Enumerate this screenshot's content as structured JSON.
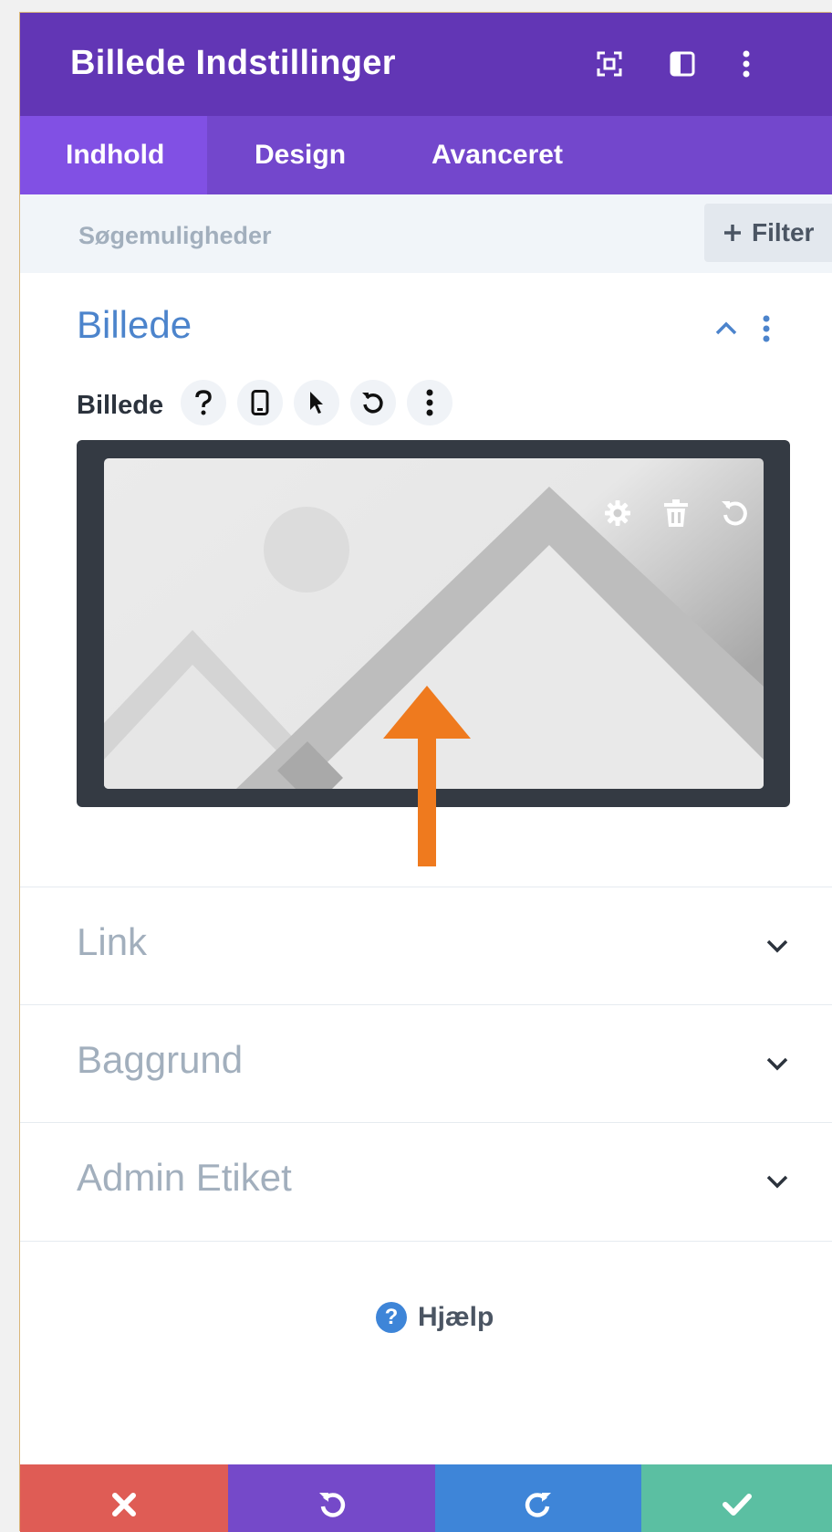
{
  "header": {
    "title": "Billede Indstillinger"
  },
  "tabs": [
    {
      "label": "Indhold",
      "active": true
    },
    {
      "label": "Design",
      "active": false
    },
    {
      "label": "Avanceret",
      "active": false
    }
  ],
  "search": {
    "placeholder": "Søgemuligheder",
    "filter_label": "Filter"
  },
  "image_section": {
    "title": "Billede",
    "field_label": "Billede"
  },
  "accordions": [
    {
      "title": "Link"
    },
    {
      "title": "Baggrund"
    },
    {
      "title": "Admin Etiket"
    }
  ],
  "help": {
    "label": "Hjælp",
    "icon_glyph": "?"
  },
  "colors": {
    "header": "#6236b5",
    "tabs": "#7347cc",
    "active_tab": "#8150e4",
    "section_title": "#4c84cc",
    "arrow": "#ef7a1e",
    "cancel": "#df5c55",
    "undo": "#7549c9",
    "redo": "#3e85d8",
    "save": "#5bbfa2"
  }
}
